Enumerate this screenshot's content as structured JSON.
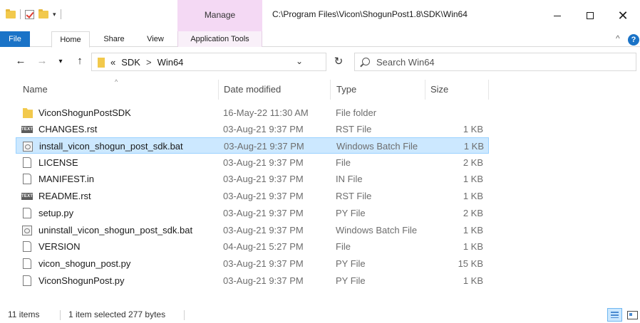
{
  "window": {
    "title_path": "C:\\Program Files\\Vicon\\ShogunPost1.8\\SDK\\Win64",
    "contextual_header": "Manage",
    "min_glyph": "—",
    "max_glyph": "☐",
    "close_glyph": "✕"
  },
  "ribbon": {
    "tabs": [
      "File",
      "Home",
      "Share",
      "View",
      "Application Tools"
    ],
    "collapse_glyph": "^",
    "help_glyph": "?"
  },
  "navigation": {
    "back_glyph": "←",
    "forward_glyph": "→",
    "recent_glyph": "⌄",
    "up_glyph": "↑",
    "breadcrumb": [
      "«",
      "SDK",
      ">",
      "Win64"
    ],
    "address_dropdown_glyph": "⌄",
    "refresh_glyph": "↻",
    "search_placeholder": "Search Win64"
  },
  "columns": [
    "Name",
    "Date modified",
    "Type",
    "Size"
  ],
  "sort_indicator": "^",
  "files": [
    {
      "name": "ViconShogunPostSDK",
      "date": "16-May-22 11:30 AM",
      "type": "File folder",
      "size": "",
      "icon": "folder-icon",
      "selected": false
    },
    {
      "name": "CHANGES.rst",
      "date": "03-Aug-21 9:37 PM",
      "type": "RST File",
      "size": "1 KB",
      "icon": "text-file-icon",
      "selected": false
    },
    {
      "name": "install_vicon_shogun_post_sdk.bat",
      "date": "03-Aug-21 9:37 PM",
      "type": "Windows Batch File",
      "size": "1 KB",
      "icon": "batch-file-icon",
      "selected": true
    },
    {
      "name": "LICENSE",
      "date": "03-Aug-21 9:37 PM",
      "type": "File",
      "size": "2 KB",
      "icon": "file-icon",
      "selected": false
    },
    {
      "name": "MANIFEST.in",
      "date": "03-Aug-21 9:37 PM",
      "type": "IN File",
      "size": "1 KB",
      "icon": "file-icon",
      "selected": false
    },
    {
      "name": "README.rst",
      "date": "03-Aug-21 9:37 PM",
      "type": "RST File",
      "size": "1 KB",
      "icon": "text-file-icon",
      "selected": false
    },
    {
      "name": "setup.py",
      "date": "03-Aug-21 9:37 PM",
      "type": "PY File",
      "size": "2 KB",
      "icon": "file-icon",
      "selected": false
    },
    {
      "name": "uninstall_vicon_shogun_post_sdk.bat",
      "date": "03-Aug-21 9:37 PM",
      "type": "Windows Batch File",
      "size": "1 KB",
      "icon": "batch-file-icon",
      "selected": false
    },
    {
      "name": "VERSION",
      "date": "04-Aug-21 5:27 PM",
      "type": "File",
      "size": "1 KB",
      "icon": "file-icon",
      "selected": false
    },
    {
      "name": "vicon_shogun_post.py",
      "date": "03-Aug-21 9:37 PM",
      "type": "PY File",
      "size": "15 KB",
      "icon": "file-icon",
      "selected": false
    },
    {
      "name": "ViconShogunPost.py",
      "date": "03-Aug-21 9:37 PM",
      "type": "PY File",
      "size": "1 KB",
      "icon": "file-icon",
      "selected": false
    }
  ],
  "status": {
    "item_count": "11 items",
    "selection": "1 item selected  277 bytes"
  },
  "colors": {
    "accent": "#1a73c7",
    "contextual_tab": "#f4d9f4",
    "selection": "#cce8ff",
    "selection_border": "#99d1ff",
    "folder": "#f2c94c"
  }
}
